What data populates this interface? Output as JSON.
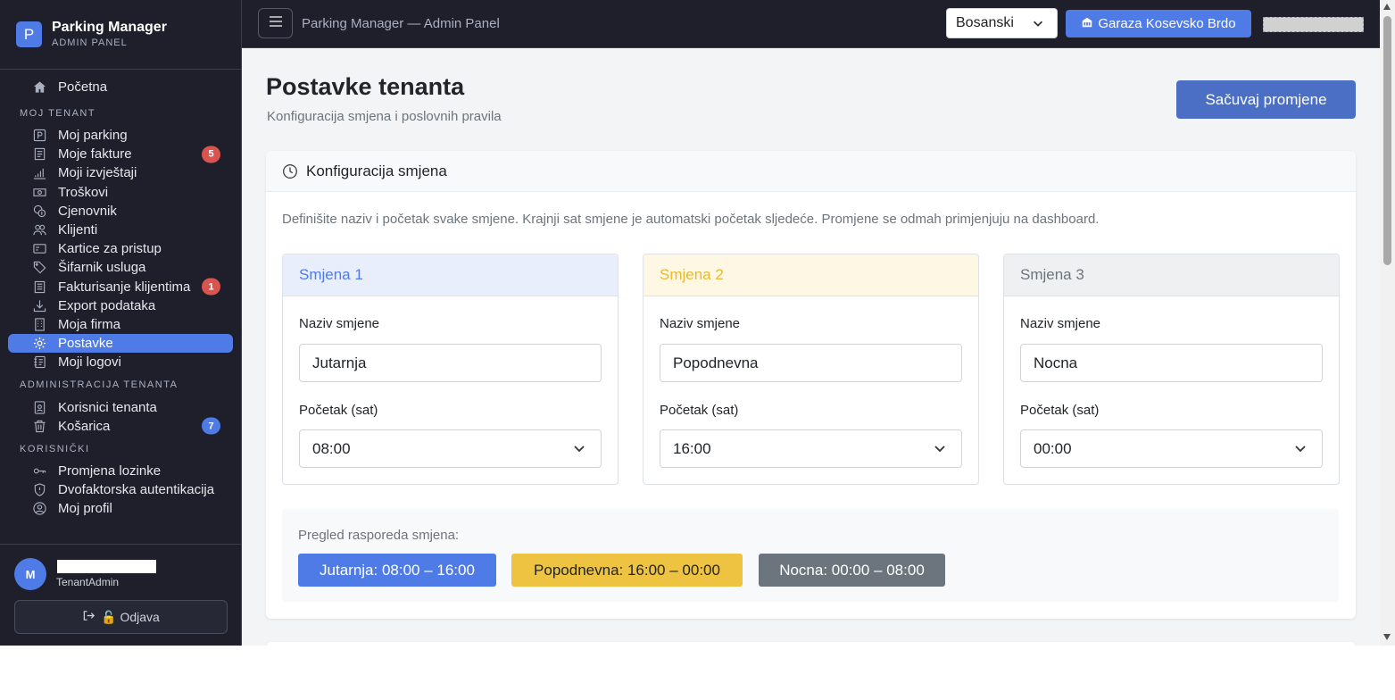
{
  "brand": {
    "logo_letter": "P",
    "title": "Parking Manager",
    "subtitle": "ADMIN PANEL"
  },
  "sidebar": {
    "home": {
      "label": "Početna",
      "icon": "home-icon"
    },
    "sections": [
      {
        "title": "MOJ TENANT",
        "items": [
          {
            "label": "Moj parking",
            "icon": "parking-icon"
          },
          {
            "label": "Moje fakture",
            "icon": "invoice-icon",
            "badge": "5",
            "badge_color": "#d9534f"
          },
          {
            "label": "Moji izvještaji",
            "icon": "bar-chart-icon"
          },
          {
            "label": "Troškovi",
            "icon": "cash-icon"
          },
          {
            "label": "Cjenovnik",
            "icon": "coins-icon"
          },
          {
            "label": "Klijenti",
            "icon": "people-icon"
          },
          {
            "label": "Kartice za pristup",
            "icon": "card-icon"
          },
          {
            "label": "Šifarnik usluga",
            "icon": "tag-icon"
          },
          {
            "label": "Fakturisanje klijentima",
            "icon": "receipt-icon",
            "badge": "1",
            "badge_color": "#d9534f"
          },
          {
            "label": "Export podataka",
            "icon": "download-icon"
          },
          {
            "label": "Moja firma",
            "icon": "building-icon"
          },
          {
            "label": "Postavke",
            "icon": "gear-icon",
            "active": true
          },
          {
            "label": "Moji logovi",
            "icon": "journal-icon"
          }
        ]
      },
      {
        "title": "ADMINISTRACIJA TENANTA",
        "items": [
          {
            "label": "Korisnici tenanta",
            "icon": "person-badge-icon"
          },
          {
            "label": "Košarica",
            "icon": "trash-icon",
            "badge": "7",
            "badge_color": "#4f7be6"
          }
        ]
      },
      {
        "title": "KORISNIČKI",
        "items": [
          {
            "label": "Promjena lozinke",
            "icon": "key-icon"
          },
          {
            "label": "Dvofaktorska autentikacija",
            "icon": "shield-icon"
          },
          {
            "label": "Moj profil",
            "icon": "person-circle-icon"
          }
        ]
      }
    ]
  },
  "user": {
    "initial": "M",
    "name": "████████████",
    "role": "TenantAdmin",
    "logout_label": "🔓 Odjava"
  },
  "topbar": {
    "title": "Parking Manager — Admin Panel",
    "language": "Bosanski",
    "garage_label": "Garaza Kosevsko Brdo",
    "user_name": "████████████"
  },
  "page": {
    "title": "Postavke tenanta",
    "subtitle": "Konfiguracija smjena i poslovnih pravila",
    "save_label": "Sačuvaj promjene"
  },
  "shift_config": {
    "title": "Konfiguracija smjena",
    "description": "Definišite naziv i početak svake smjene. Krajnji sat smjene je automatski početak sljedeće. Promjene se odmah primjenjuju na dashboard.",
    "name_label": "Naziv smjene",
    "start_label": "Početak (sat)",
    "shifts": [
      {
        "header": "Smjena 1",
        "name": "Jutarnja",
        "start": "08:00",
        "header_bg": "#e8eefc",
        "header_color": "#4f7be6"
      },
      {
        "header": "Smjena 2",
        "name": "Popodnevna",
        "start": "16:00",
        "header_bg": "#fdf7e3",
        "header_color": "#e8b92e"
      },
      {
        "header": "Smjena 3",
        "name": "Nocna",
        "start": "00:00",
        "header_bg": "#eef0f2",
        "header_color": "#6c757d"
      }
    ],
    "preview_label": "Pregled rasporeda smjena:",
    "preview": [
      {
        "text": "Jutarnja: 08:00 – 16:00",
        "bg": "#4f7be6",
        "color": "#ffffff"
      },
      {
        "text": "Popodnevna: 16:00 – 00:00",
        "bg": "#eec342",
        "color": "#212529"
      },
      {
        "text": "Nocna: 00:00 – 08:00",
        "bg": "#6c757d",
        "color": "#ffffff"
      }
    ]
  }
}
